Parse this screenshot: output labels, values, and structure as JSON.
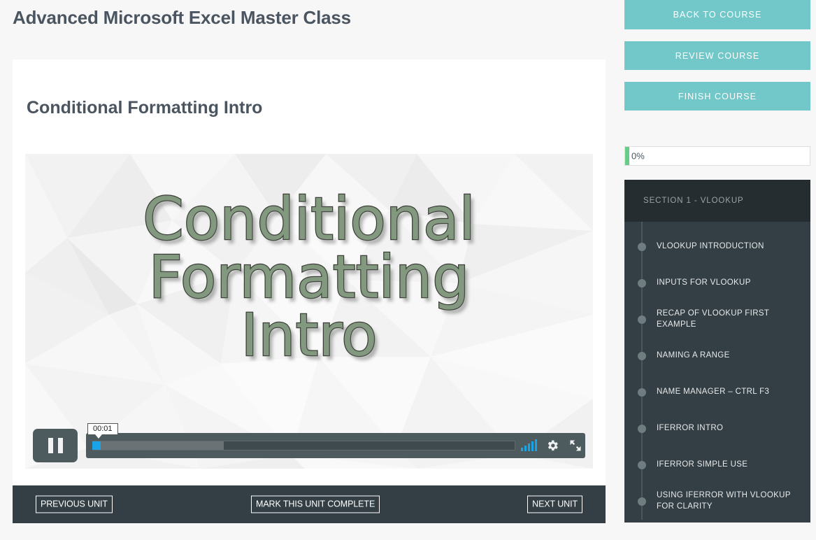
{
  "course_title": "Advanced Microsoft Excel Master Class",
  "lesson": {
    "title": "Conditional Formatting Intro",
    "video_text_line1": "Conditional",
    "video_text_line2": "Formatting",
    "video_text_line3": "Intro"
  },
  "player": {
    "pause_label": "Pause",
    "current_time": "00:01",
    "volume_icon": "volume-bars-icon",
    "settings_icon": "gear-icon",
    "fullscreen_icon": "fullscreen-icon",
    "played_percent": 2,
    "buffered_percent": 31
  },
  "footer_nav": {
    "previous": "PREVIOUS UNIT",
    "mark_complete": "MARK THIS UNIT COMPLETE",
    "next": "NEXT UNIT"
  },
  "sidebar": {
    "buttons": [
      {
        "label": "BACK TO COURSE"
      },
      {
        "label": "REVIEW COURSE"
      },
      {
        "label": "FINISH COURSE"
      }
    ],
    "progress": {
      "label": "0%",
      "value": 0
    },
    "section_title": "SECTION 1 - VLOOKUP",
    "lessons": [
      {
        "label": "VLOOKUP INTRODUCTION"
      },
      {
        "label": "INPUTS FOR VLOOKUP"
      },
      {
        "label": "RECAP OF VLOOKUP FIRST EXAMPLE"
      },
      {
        "label": "NAMING A RANGE"
      },
      {
        "label": "NAME MANAGER – CTRL F3"
      },
      {
        "label": "IFERROR INTRO"
      },
      {
        "label": "IFERROR SIMPLE USE"
      },
      {
        "label": "USING IFERROR WITH VLOOKUP FOR CLARITY"
      }
    ]
  },
  "colors": {
    "accent_teal": "#72c7c9",
    "dark_panel": "#333f44",
    "section_header": "#252d31",
    "progress_green": "#66cc88",
    "player_blue": "#1aa4e8",
    "title_text": "#4a5560",
    "video_text": "#83997f",
    "page_background": "#f7f7f8"
  }
}
